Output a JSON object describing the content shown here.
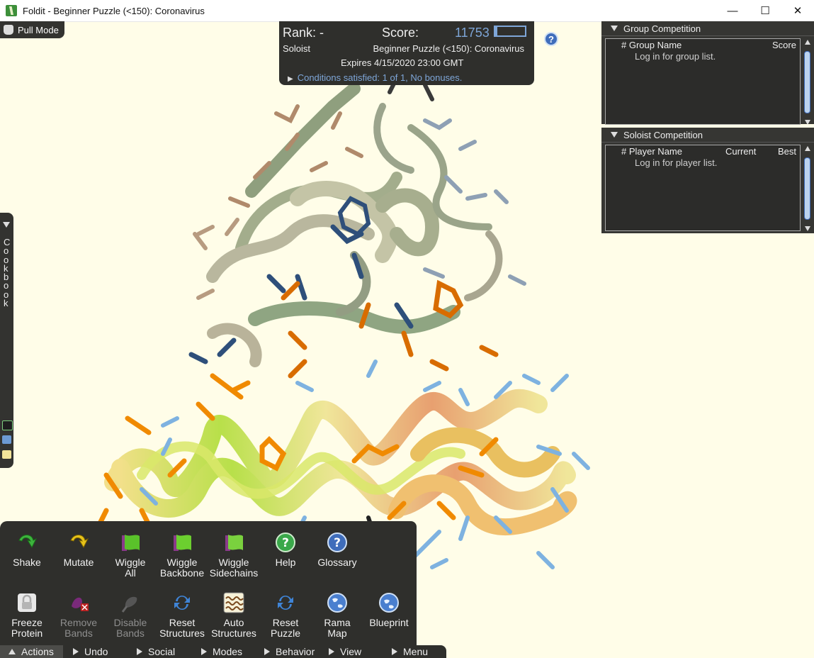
{
  "window": {
    "title": "Foldit - Beginner Puzzle (<150): Coronavirus",
    "controls": {
      "minimize": "—",
      "maximize": "☐",
      "close": "✕"
    }
  },
  "pull_mode": {
    "label": "Pull Mode"
  },
  "score_panel": {
    "rank": "Rank: -",
    "score_label": "Score:",
    "score_value": "11753",
    "mode": "Soloist",
    "puzzle_name": "Beginner Puzzle (<150): Coronavirus",
    "expires": "Expires 4/15/2020 23:00 GMT",
    "conditions": "Conditions satisfied: 1 of 1, No bonuses."
  },
  "help_icon": "?",
  "group_competition": {
    "title": "Group Competition",
    "columns": [
      "# Group Name",
      "Score"
    ],
    "note": "Log in for group list."
  },
  "soloist_competition": {
    "title": "Soloist Competition",
    "columns": [
      "# Player Name",
      "Current",
      "Best"
    ],
    "note": "Log in for player list."
  },
  "cookbook": {
    "label": "C o o k b o o k"
  },
  "actions": {
    "row1": [
      {
        "label1": "Shake",
        "label2": "",
        "icon": "shake-icon",
        "enabled": true
      },
      {
        "label1": "Mutate",
        "label2": "",
        "icon": "mutate-icon",
        "enabled": true
      },
      {
        "label1": "Wiggle",
        "label2": "All",
        "icon": "wiggle-all-icon",
        "enabled": true
      },
      {
        "label1": "Wiggle",
        "label2": "Backbone",
        "icon": "wiggle-backbone-icon",
        "enabled": true
      },
      {
        "label1": "Wiggle",
        "label2": "Sidechains",
        "icon": "wiggle-sidechains-icon",
        "enabled": true
      },
      {
        "label1": "Help",
        "label2": "",
        "icon": "help-icon",
        "enabled": true
      },
      {
        "label1": "Glossary",
        "label2": "",
        "icon": "glossary-icon",
        "enabled": true
      }
    ],
    "row2": [
      {
        "label1": "Freeze",
        "label2": "Protein",
        "icon": "lock-icon",
        "enabled": true
      },
      {
        "label1": "Remove",
        "label2": "Bands",
        "icon": "remove-bands-icon",
        "enabled": false
      },
      {
        "label1": "Disable",
        "label2": "Bands",
        "icon": "disable-bands-icon",
        "enabled": false
      },
      {
        "label1": "Reset",
        "label2": "Structures",
        "icon": "reset-structures-icon",
        "enabled": true
      },
      {
        "label1": "Auto",
        "label2": "Structures",
        "icon": "auto-structures-icon",
        "enabled": true
      },
      {
        "label1": "Reset",
        "label2": "Puzzle",
        "icon": "reset-puzzle-icon",
        "enabled": true
      },
      {
        "label1": "Rama",
        "label2": "Map",
        "icon": "rama-map-icon",
        "enabled": true
      },
      {
        "label1": "Blueprint",
        "label2": "",
        "icon": "blueprint-icon",
        "enabled": true
      }
    ]
  },
  "bottom_bar": {
    "actions": "Actions",
    "undo": "Undo",
    "social": "Social",
    "modes": "Modes",
    "behavior": "Behavior",
    "view": "View",
    "menu": "Menu"
  },
  "colors": {
    "background": "#fffde8",
    "panel": "#2f2f2c",
    "accent_blue": "#7ea6d8",
    "orange": "#e07000",
    "steel_blue": "#2e4f7a"
  }
}
